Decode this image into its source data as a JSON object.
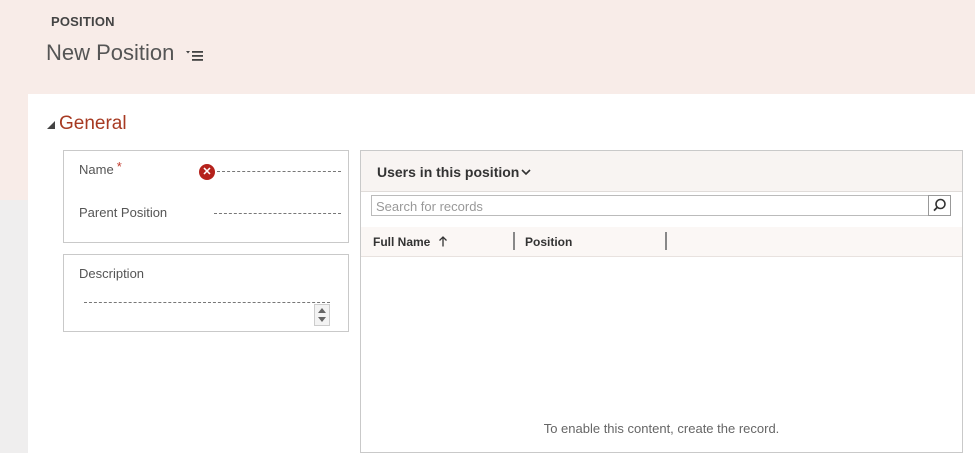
{
  "header": {
    "entity_label": "POSITION",
    "record_title": "New Position"
  },
  "section": {
    "title": "General"
  },
  "fields": {
    "name_label": "Name",
    "required_mark": "*",
    "name_value": "",
    "error_symbol": "✕",
    "parent_label": "Parent Position",
    "parent_value": "",
    "description_label": "Description",
    "description_value": ""
  },
  "subgrid": {
    "title": "Users in this position",
    "search_placeholder": "Search for records",
    "columns": [
      {
        "label": "Full Name",
        "sort": "ascending"
      },
      {
        "label": "Position"
      }
    ],
    "empty_message": "To enable this content, create the record."
  },
  "colors": {
    "accent": "#a73a22",
    "error": "#b5221c",
    "header_bg": "#f8ece8"
  }
}
